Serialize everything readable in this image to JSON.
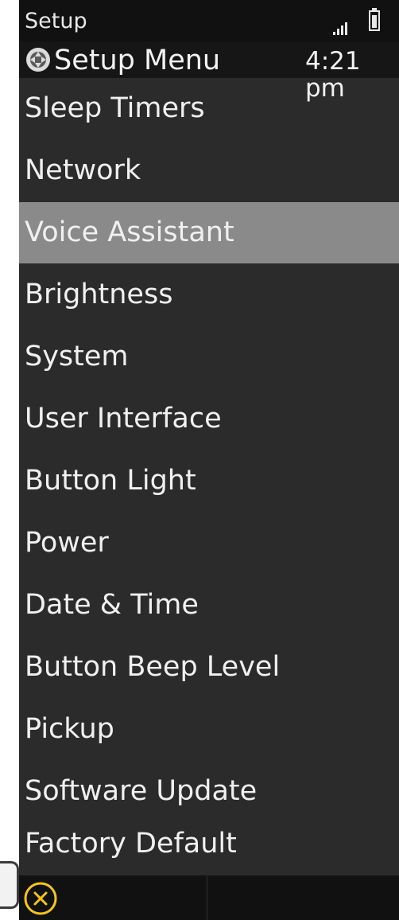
{
  "status_bar": {
    "app_name": "Setup",
    "signal_icon": "signal-bars-icon",
    "battery_icon": "battery-icon"
  },
  "title_bar": {
    "icon": "setup-gear-icon",
    "title": "Setup Menu",
    "time": "4:21 pm"
  },
  "menu": {
    "selected_index": 2,
    "items": [
      {
        "label": "Sleep Timers"
      },
      {
        "label": "Network"
      },
      {
        "label": "Voice Assistant"
      },
      {
        "label": "Brightness"
      },
      {
        "label": "System"
      },
      {
        "label": "User Interface"
      },
      {
        "label": "Button Light"
      },
      {
        "label": "Power"
      },
      {
        "label": "Date & Time"
      },
      {
        "label": "Button Beep Level"
      },
      {
        "label": "Pickup"
      },
      {
        "label": "Software Update"
      },
      {
        "label": "Factory Default"
      }
    ]
  },
  "bottom_bar": {
    "close_icon": "close-circle-icon"
  },
  "colors": {
    "background": "#2b2b2b",
    "selected": "#8a8a8a",
    "bars": "#111111",
    "accent": "#f5c518"
  }
}
